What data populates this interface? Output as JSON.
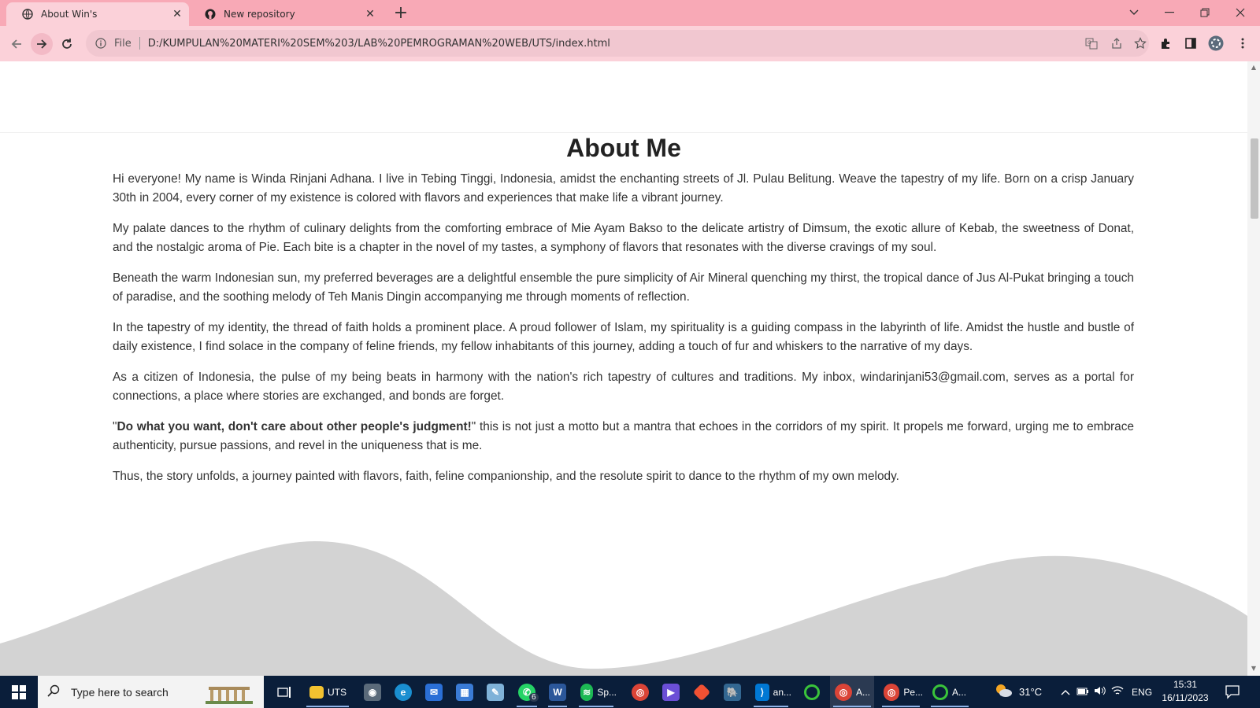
{
  "browser": {
    "tabs": [
      {
        "title": "About Win's",
        "active": true
      },
      {
        "title": "New repository",
        "active": false
      }
    ],
    "address": {
      "scheme": "File",
      "url": "D:/KUMPULAN%20MATERI%20SEM%203/LAB%20PEMROGRAMAN%20WEB/UTS/index.html"
    }
  },
  "page": {
    "heading": "About Me",
    "paragraphs": {
      "p1": "Hi everyone! My name is Winda Rinjani Adhana. I live in Tebing Tinggi, Indonesia, amidst the enchanting streets of Jl. Pulau Belitung. Weave the tapestry of my life. Born on a crisp January 30th in 2004, every corner of my existence is colored with flavors and experiences that make life a vibrant journey.",
      "p2": "My palate dances to the rhythm of culinary delights from the comforting embrace of Mie Ayam Bakso to the delicate artistry of Dimsum, the exotic allure of Kebab, the sweetness of Donat, and the nostalgic aroma of Pie. Each bite is a chapter in the novel of my tastes, a symphony of flavors that resonates with the diverse cravings of my soul.",
      "p3": "Beneath the warm Indonesian sun, my preferred beverages are a delightful ensemble the pure simplicity of Air Mineral quenching my thirst, the tropical dance of Jus Al-Pukat bringing a touch of paradise, and the soothing melody of Teh Manis Dingin accompanying me through moments of reflection.",
      "p4": "In the tapestry of my identity, the thread of faith holds a prominent place. A proud follower of Islam, my spirituality is a guiding compass in the labyrinth of life. Amidst the hustle and bustle of daily existence, I find solace in the company of feline friends, my fellow inhabitants of this journey, adding a touch of fur and whiskers to the narrative of my days.",
      "p5": "As a citizen of Indonesia, the pulse of my being beats in harmony with the nation's rich tapestry of cultures and traditions. My inbox, windarinjani53@gmail.com, serves as a portal for connections, a place where stories are exchanged, and bonds are forget.",
      "p6_open_quote": "\"",
      "p6_motto": "Do what you want, don't care about other people's judgment!",
      "p6_rest": "\" this is not just a motto but a mantra that echoes in the corridors of my spirit. It propels me forward, urging me to embrace authenticity, pursue passions, and revel in the uniqueness that is me.",
      "p7": "Thus, the story unfolds, a journey painted with flavors, faith, feline companionship, and the resolute spirit to dance to the rhythm of my own melody."
    }
  },
  "taskbar": {
    "search_placeholder": "Type here to search",
    "apps": {
      "explorer": "UTS",
      "whatsapp_badge": "6",
      "spotify": "Sp...",
      "vscode": "an...",
      "chrome_active": "A...",
      "chrome_2": "Pe...",
      "app_last": "A..."
    },
    "weather": "31°C",
    "language": "ENG",
    "time": "15:31",
    "date": "16/11/2023"
  },
  "colors": {
    "tabbar": "#f8a9b6",
    "toolbar": "#fbd1d9",
    "wave": "#d3d3d3",
    "taskbar": "#0a1e3a"
  }
}
